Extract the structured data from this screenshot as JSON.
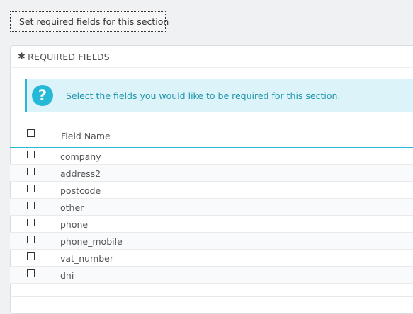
{
  "toolbar": {
    "set_required_label": "Set required fields for this section",
    "plus_icon": "plus-circle-icon"
  },
  "panel": {
    "title": "REQUIRED FIELDS",
    "title_icon": "asterisk-icon"
  },
  "alert": {
    "icon": "question-icon",
    "icon_glyph": "?",
    "text": "Select the fields you would like to be required for this section."
  },
  "table": {
    "column_header": "Field Name",
    "rows": [
      {
        "name": "company",
        "checked": false
      },
      {
        "name": "address2",
        "checked": false
      },
      {
        "name": "postcode",
        "checked": false
      },
      {
        "name": "other",
        "checked": false
      },
      {
        "name": "phone",
        "checked": false
      },
      {
        "name": "phone_mobile",
        "checked": false
      },
      {
        "name": "vat_number",
        "checked": false
      },
      {
        "name": "dni",
        "checked": false
      }
    ]
  },
  "colors": {
    "accent": "#25b9d7",
    "alert_bg": "#dcf4f9",
    "alert_text": "#1e94ab"
  }
}
